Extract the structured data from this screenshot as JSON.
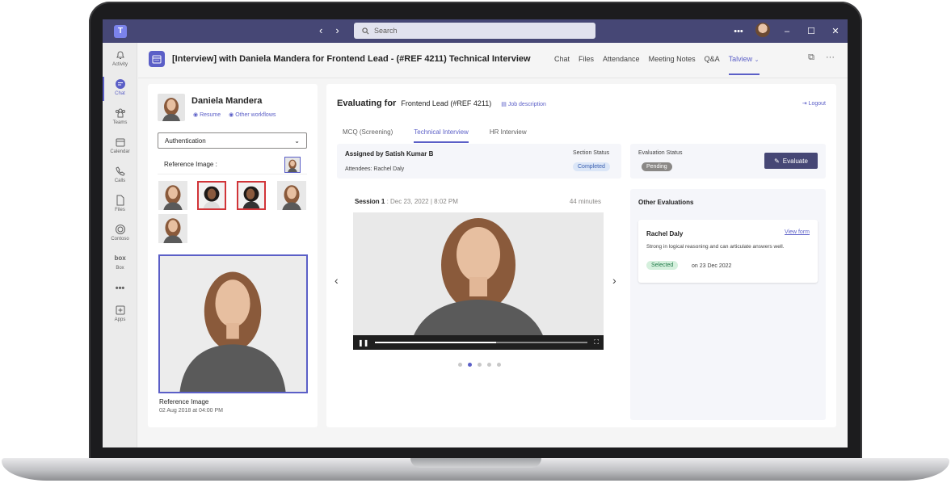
{
  "titlebar": {
    "search_placeholder": "Search",
    "more": "•••",
    "min": "–",
    "max": "☐",
    "close": "✕"
  },
  "rail": [
    {
      "label": "Activity"
    },
    {
      "label": "Chat"
    },
    {
      "label": "Teams"
    },
    {
      "label": "Calendar"
    },
    {
      "label": "Calls"
    },
    {
      "label": "Files"
    },
    {
      "label": "Contoso"
    },
    {
      "label": "Box"
    },
    {
      "label": "•••"
    },
    {
      "label": "Apps"
    }
  ],
  "header": {
    "title": "[Interview] with Daniela Mandera for Frontend Lead - (#REF 4211) Technical Interview",
    "tabs": [
      "Chat",
      "Files",
      "Attendance",
      "Meeting Notes",
      "Q&A",
      "Talview"
    ],
    "active_tab": "Talview"
  },
  "candidate": {
    "name": "Daniela Mandera",
    "resume_label": "Resume",
    "workflows_label": "Other workflows",
    "dropdown_value": "Authentication",
    "reference_label": "Reference Image :",
    "ref_caption": "Reference Image",
    "ref_date": "02 Aug 2018 at 04:00 PM"
  },
  "evaluation": {
    "prefix": "Evaluating for",
    "role": "Frontend Lead (#REF 4211)",
    "job_desc": "Job description",
    "logout": "Logout",
    "tabs": [
      "MCQ (Screening)",
      "Technical Interview",
      "HR Interview"
    ],
    "active_tab": "Technical Interview",
    "assigned_by": "Assigned by Satish Kumar B",
    "attendees": "Attendees: Rachel Daly",
    "section_status_label": "Section Status",
    "section_status": "Completed",
    "eval_status_label": "Evaluation Status",
    "eval_status": "Pending",
    "evaluate_button": "Evaluate"
  },
  "session": {
    "label": "Session 1",
    "date": " : Dec 23, 2022 | 8:02 PM",
    "duration": "44 minutes",
    "progress": 0.57,
    "dots": 5,
    "active_dot": 1
  },
  "other_evaluations": {
    "title": "Other Evaluations",
    "reviewer": "Rachel Daly",
    "view_form": "View form",
    "comment": "Strong in logical reasoning and can articulate answers well.",
    "result": "Selected",
    "date": "on 23 Dec 2022"
  },
  "colors": {
    "titlebar": "#464775",
    "accent": "#5b5fc7",
    "completed_bg": "#dbe6f7",
    "pending_bg": "#8a8886",
    "selected_bg": "#d5f0dd",
    "flag_border": "#d13438"
  }
}
